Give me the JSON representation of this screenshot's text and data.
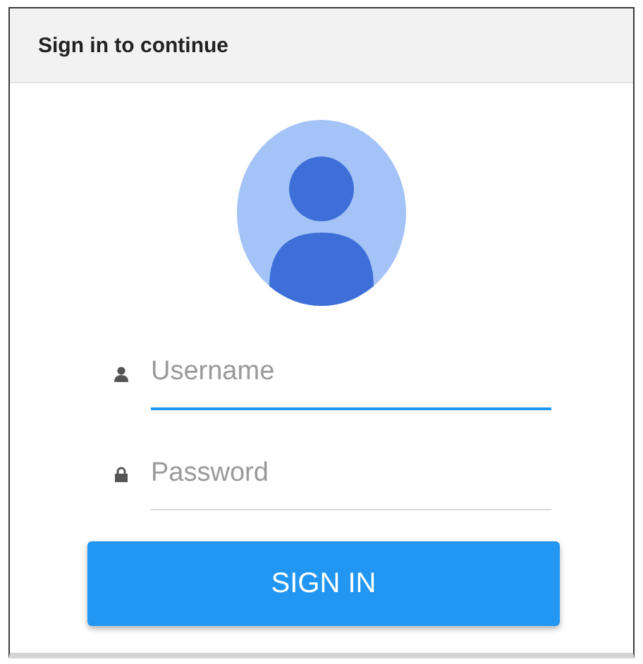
{
  "header": {
    "title": "Sign in to continue"
  },
  "fields": [
    {
      "kind": "user",
      "placeholder": "Username",
      "focused": true
    },
    {
      "kind": "lock",
      "placeholder": "Password",
      "focused": false
    }
  ],
  "button": {
    "label": "SIGN IN"
  }
}
